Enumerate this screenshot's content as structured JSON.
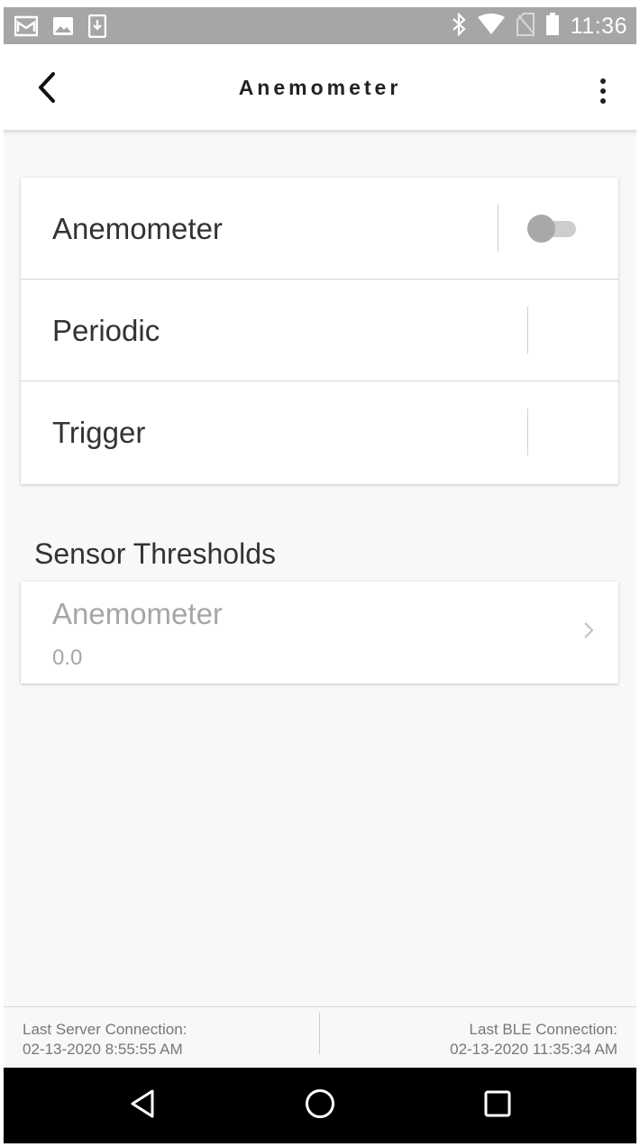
{
  "status_bar": {
    "time": "11:36",
    "left_icons": [
      "mail-icon",
      "image-icon",
      "download-icon"
    ],
    "right_icons": [
      "bluetooth-icon",
      "wifi-icon",
      "no-sim-icon",
      "battery-icon"
    ]
  },
  "app_bar": {
    "title": "Anemometer",
    "back_icon": "chevron-left-icon",
    "menu_icon": "more-vert-icon"
  },
  "settings": {
    "rows": [
      {
        "label": "Anemometer",
        "control": "toggle",
        "toggle_on": false
      },
      {
        "label": "Periodic"
      },
      {
        "label": "Trigger"
      }
    ]
  },
  "thresholds": {
    "section_title": "Sensor Thresholds",
    "items": [
      {
        "name": "Anemometer",
        "value": "0.0"
      }
    ]
  },
  "footer": {
    "server_label": "Last Server Connection:",
    "server_time": "02-13-2020 8:55:55 AM",
    "ble_label": "Last BLE Connection:",
    "ble_time": "02-13-2020 11:35:34 AM"
  },
  "nav_bar": {
    "buttons": [
      "back-triangle-icon",
      "home-circle-icon",
      "recents-square-icon"
    ]
  },
  "colors": {
    "status_bar": "#a6a6a6",
    "app_bar": "#ffffff",
    "background": "#f8f8f8",
    "nav_bar": "#000000",
    "toggle_off_thumb": "#a8a8a8",
    "toggle_off_track": "#cdcdcd",
    "muted_text": "#a6a6a6"
  }
}
